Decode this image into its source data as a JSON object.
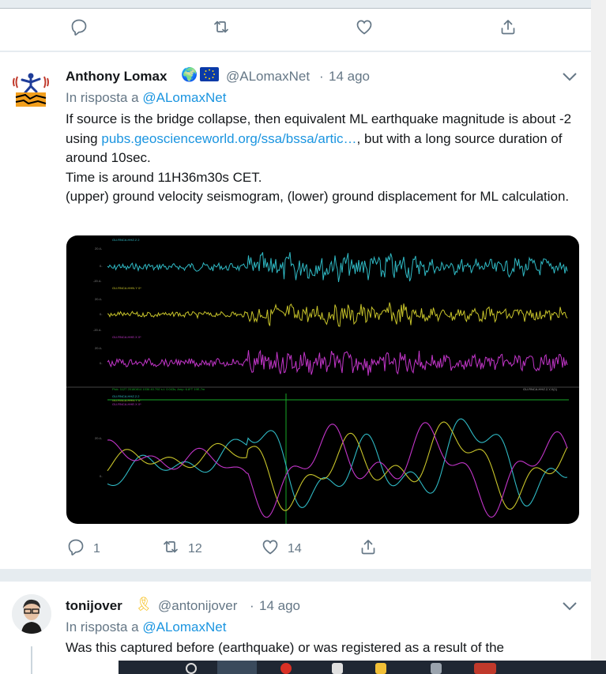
{
  "previous_tweet": {
    "actions": {
      "reply_icon": "reply-icon",
      "retweet_icon": "retweet-icon",
      "like_icon": "heart-icon",
      "share_icon": "share-icon"
    }
  },
  "tweet": {
    "author_name": "Anthony Lomax",
    "emoji_badges": [
      "🌍",
      "🇪🇺"
    ],
    "handle": "@ALomaxNet",
    "separator": "·",
    "time": "14 ago",
    "reply_prefix": "In risposta a",
    "reply_to": "@ALomaxNet",
    "text_before_link": "If source is the bridge collapse, then equivalent ML earthquake magnitude is about -2 using ",
    "link": "pubs.geoscienceworld.org/ssa/bssa/artic…",
    "text_after_link": ", but with a long source duration of around 10sec.",
    "line2": "Time is around 11H36m30s CET.",
    "line3": "(upper) ground velocity seismogram, (lower) ground displacement for ML calculation.",
    "media": {
      "trace_labels": [
        "GU.RNCA.HHZ.2 2",
        "GU.RNCA.HHN.Y 0*",
        "GU.RNCA.HHE.X 0*"
      ],
      "status_text": "Pick: 1127 20180814 1036 40.792 s.t. 0.043s, Amp: 6.8*T 19E-7m",
      "right_label": "GU.RNCA.HHZ.2,Y,X(1)",
      "lower_legend": [
        "GU.RNCA.HHZ.2.2",
        "GU.RNCA.HHN.Y 0*",
        "GU.RNCA.HHE.X 0*"
      ],
      "axis_ticks": [
        "20.4-",
        "0-",
        "-20.4-",
        "20.4-",
        "0-",
        "-20.4-",
        "20.4-",
        "0-",
        "20.4-",
        "0-"
      ]
    },
    "counts": {
      "replies": "1",
      "retweets": "12",
      "likes": "14"
    }
  },
  "next_tweet": {
    "author_name": "tonijover",
    "ribbon": "🎗",
    "handle": "@antonijover",
    "separator": "·",
    "time": "14 ago",
    "reply_prefix": "In risposta a",
    "reply_to": "@ALomaxNet",
    "text": "Was this captured before (earthquake) or was registered as a result of the"
  },
  "colors": {
    "link": "#1b95e0",
    "muted": "#657786",
    "cyan_trace": "#2fb9c4",
    "yellow_trace": "#c8c42a",
    "magenta_trace": "#c235c9",
    "green_marker": "#18a828"
  }
}
